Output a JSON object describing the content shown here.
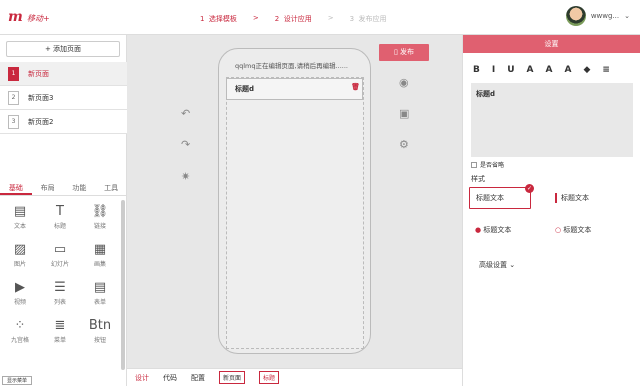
{
  "app": {
    "logo": "m",
    "name": "移动+"
  },
  "steps": [
    {
      "num": "1",
      "label": "选择模板"
    },
    {
      "sep": ">"
    },
    {
      "num": "2",
      "label": "设计应用"
    },
    {
      "sep": ">"
    },
    {
      "num": "3",
      "label": "发布应用"
    }
  ],
  "user": {
    "name": "wwwg..."
  },
  "left": {
    "add_page": "+ 添加页面",
    "pages": [
      {
        "num": "1",
        "label": "新页面"
      },
      {
        "num": "2",
        "label": "新页面3"
      },
      {
        "num": "3",
        "label": "新页面2"
      }
    ],
    "tabs": [
      "基础",
      "布局",
      "功能",
      "工具"
    ],
    "components": [
      {
        "icon": "▤",
        "label": "文本"
      },
      {
        "icon": "T",
        "label": "标题"
      },
      {
        "icon": "⛓",
        "label": "链接"
      },
      {
        "icon": "▨",
        "label": "图片"
      },
      {
        "icon": "▭",
        "label": "幻灯片"
      },
      {
        "icon": "▦",
        "label": "画集"
      },
      {
        "icon": "▶",
        "label": "视频"
      },
      {
        "icon": "☰",
        "label": "列表"
      },
      {
        "icon": "▤",
        "label": "表单"
      },
      {
        "icon": "⁘",
        "label": "九宫格"
      },
      {
        "icon": "≣",
        "label": "菜单"
      },
      {
        "icon": "Btn",
        "label": "按钮"
      }
    ],
    "tip": "显示菜单"
  },
  "canvas": {
    "phone_title": "qqlmq正在编辑页面,请稍后再编辑......",
    "block_title": "标题d",
    "publish": "发布"
  },
  "bottom": {
    "items": [
      "设计",
      "代码",
      "配置"
    ],
    "chips": [
      "新页面",
      "标题"
    ]
  },
  "right": {
    "header": "设置",
    "toolbar": [
      "B",
      "I",
      "U",
      "A",
      "A",
      "A",
      "◆",
      "≡"
    ],
    "editor_text": "标题d",
    "checkbox_label": "是否省略",
    "style_label": "样式",
    "styles": [
      "标题文本",
      "标题文本",
      "标题文本",
      "标题文本"
    ],
    "advanced": "高级设置"
  }
}
